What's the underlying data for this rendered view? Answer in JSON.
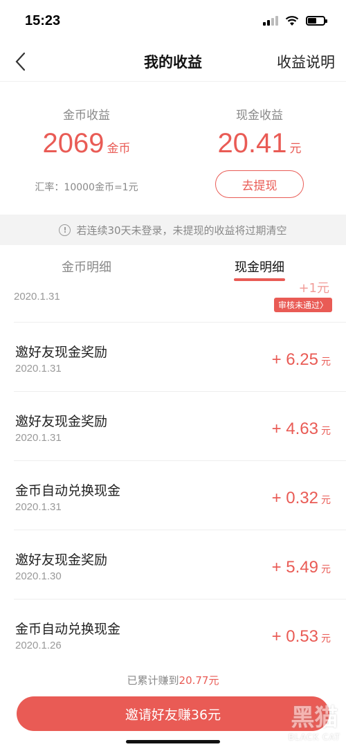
{
  "status": {
    "time": "15:23"
  },
  "nav": {
    "title": "我的收益",
    "right": "收益说明"
  },
  "earnings": {
    "coin_label": "金币收益",
    "coin_value": "2069",
    "coin_unit": "金币",
    "cash_label": "现金收益",
    "cash_value": "20.41",
    "cash_unit": "元",
    "rate": "汇率：10000金币=1元",
    "withdraw": "去提现"
  },
  "notice": "若连续30天未登录，未提现的收益将过期清空",
  "tabs": {
    "coin": "金币明细",
    "cash": "现金明细"
  },
  "partial": {
    "date": "2020.1.31",
    "amount": "+1元",
    "badge": "审核未通过〉"
  },
  "rows": [
    {
      "title": "邀好友现金奖励",
      "date": "2020.1.31",
      "amount": "+ 6.25",
      "unit": "元"
    },
    {
      "title": "邀好友现金奖励",
      "date": "2020.1.31",
      "amount": "+ 4.63",
      "unit": "元"
    },
    {
      "title": "金币自动兑换现金",
      "date": "2020.1.31",
      "amount": "+ 0.32",
      "unit": "元"
    },
    {
      "title": "邀好友现金奖励",
      "date": "2020.1.30",
      "amount": "+ 5.49",
      "unit": "元"
    },
    {
      "title": "金币自动兑换现金",
      "date": "2020.1.26",
      "amount": "+ 0.53",
      "unit": "元"
    }
  ],
  "footer": {
    "total_prefix": "已累计赚到",
    "total_value": "20.77元",
    "invite": "邀请好友赚36元"
  },
  "watermark": {
    "cn": "黑猫",
    "en": "BLACK CAT"
  },
  "colors": {
    "accent": "#e95b55"
  }
}
